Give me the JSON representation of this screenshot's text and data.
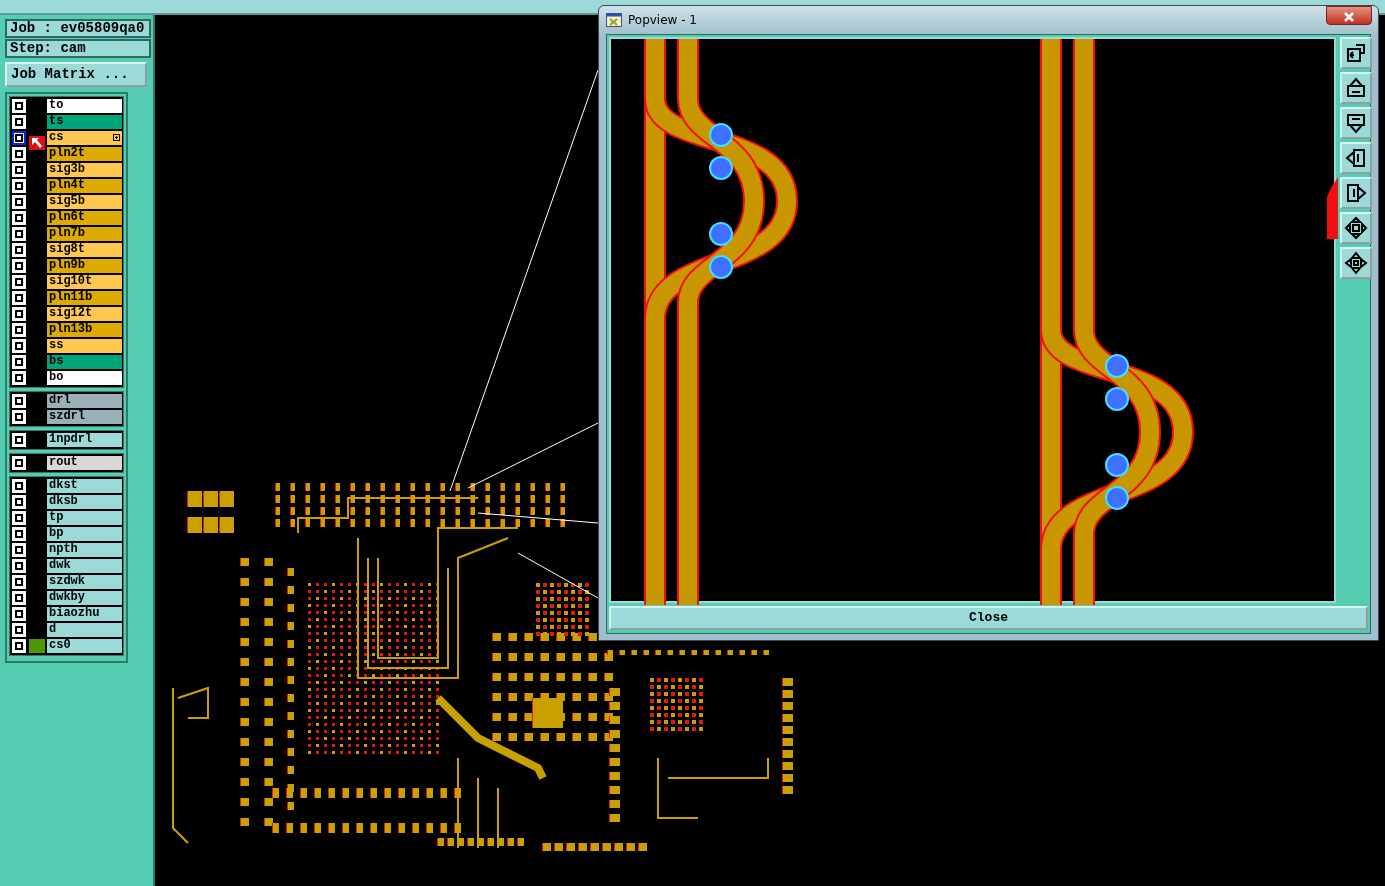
{
  "job_label": "Job : ev05809qa0",
  "step_label": "Step: cam",
  "matrix_button": "Job Matrix ...",
  "layer_groups": [
    {
      "layers": [
        {
          "name": "to",
          "color": "#ffffff",
          "selected": false,
          "expandable": false,
          "marked": false
        },
        {
          "name": "ts",
          "color": "#00a67a",
          "selected": false,
          "expandable": false,
          "marked": false
        },
        {
          "name": "cs",
          "color": "#ffc850",
          "selected": true,
          "expandable": true,
          "marked": false
        },
        {
          "name": "pln2t",
          "color": "#dcaa00",
          "selected": false,
          "expandable": false,
          "marked": false
        },
        {
          "name": "sig3b",
          "color": "#ffc850",
          "selected": false,
          "expandable": false,
          "marked": false
        },
        {
          "name": "pln4t",
          "color": "#dcaa00",
          "selected": false,
          "expandable": false,
          "marked": false
        },
        {
          "name": "sig5b",
          "color": "#ffc850",
          "selected": false,
          "expandable": false,
          "marked": false
        },
        {
          "name": "pln6t",
          "color": "#dcaa00",
          "selected": false,
          "expandable": false,
          "marked": false
        },
        {
          "name": "pln7b",
          "color": "#dcaa00",
          "selected": false,
          "expandable": false,
          "marked": false
        },
        {
          "name": "sig8t",
          "color": "#ffc850",
          "selected": false,
          "expandable": false,
          "marked": false
        },
        {
          "name": "pln9b",
          "color": "#dcaa00",
          "selected": false,
          "expandable": false,
          "marked": false
        },
        {
          "name": "sig10t",
          "color": "#ffc850",
          "selected": false,
          "expandable": false,
          "marked": false
        },
        {
          "name": "pln11b",
          "color": "#dcaa00",
          "selected": false,
          "expandable": false,
          "marked": false
        },
        {
          "name": "sig12t",
          "color": "#ffc850",
          "selected": false,
          "expandable": false,
          "marked": false
        },
        {
          "name": "pln13b",
          "color": "#dcaa00",
          "selected": false,
          "expandable": false,
          "marked": false
        },
        {
          "name": "ss",
          "color": "#ffc850",
          "selected": false,
          "expandable": false,
          "marked": false
        },
        {
          "name": "bs",
          "color": "#00a67a",
          "selected": false,
          "expandable": false,
          "marked": false
        },
        {
          "name": "bo",
          "color": "#ffffff",
          "selected": false,
          "expandable": false,
          "marked": false
        }
      ]
    },
    {
      "layers": [
        {
          "name": "drl",
          "color": "#9ab0b8",
          "selected": false,
          "expandable": false,
          "marked": false
        },
        {
          "name": "szdrl",
          "color": "#9ab0b8",
          "selected": false,
          "expandable": false,
          "marked": false
        }
      ]
    },
    {
      "layers": [
        {
          "name": "1npdrl",
          "color": "#9cd9d9",
          "selected": false,
          "expandable": false,
          "marked": false
        }
      ]
    },
    {
      "layers": [
        {
          "name": "rout",
          "color": "#d8d8d8",
          "selected": false,
          "expandable": false,
          "marked": false
        }
      ]
    },
    {
      "layers": [
        {
          "name": "dkst",
          "color": "#9cd9d9",
          "selected": false,
          "expandable": false,
          "marked": false
        },
        {
          "name": "dksb",
          "color": "#9cd9d9",
          "selected": false,
          "expandable": false,
          "marked": false
        },
        {
          "name": "tp",
          "color": "#9cd9d9",
          "selected": false,
          "expandable": false,
          "marked": false
        },
        {
          "name": "bp",
          "color": "#9cd9d9",
          "selected": false,
          "expandable": false,
          "marked": false
        },
        {
          "name": "npth",
          "color": "#9cd9d9",
          "selected": false,
          "expandable": false,
          "marked": false
        },
        {
          "name": "dwk",
          "color": "#9cd9d9",
          "selected": false,
          "expandable": false,
          "marked": false
        },
        {
          "name": "szdwk",
          "color": "#9cd9d9",
          "selected": false,
          "expandable": false,
          "marked": false
        },
        {
          "name": "dwkby",
          "color": "#9cd9d9",
          "selected": false,
          "expandable": false,
          "marked": false
        },
        {
          "name": "biaozhu",
          "color": "#9cd9d9",
          "selected": false,
          "expandable": false,
          "marked": false
        },
        {
          "name": "d",
          "color": "#9cd9d9",
          "selected": false,
          "expandable": false,
          "marked": false
        },
        {
          "name": "cs0",
          "color": "#9cd9d9",
          "selected": false,
          "expandable": false,
          "marked": true
        }
      ]
    }
  ],
  "popview": {
    "title": "Popview - 1",
    "close_button": "Close",
    "tools": [
      {
        "kind": "restore"
      },
      {
        "kind": "up"
      },
      {
        "kind": "down"
      },
      {
        "kind": "left"
      },
      {
        "kind": "right"
      },
      {
        "kind": "fit"
      },
      {
        "kind": "pan"
      }
    ]
  }
}
